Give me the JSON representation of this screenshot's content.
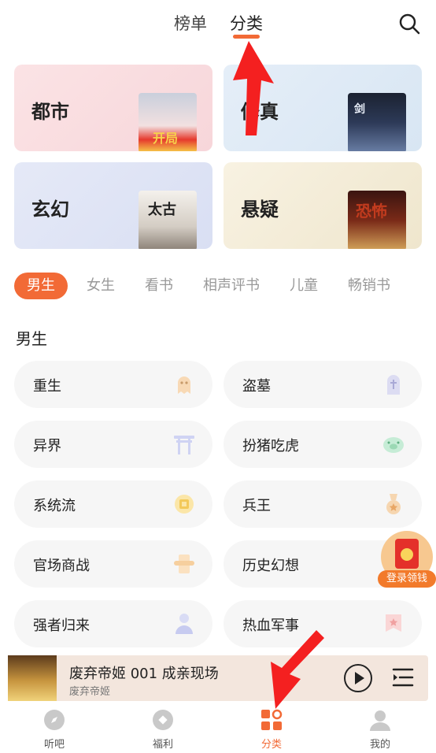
{
  "header": {
    "tabs": [
      {
        "label": "榜单",
        "active": false
      },
      {
        "label": "分类",
        "active": true
      }
    ],
    "search_icon": "search-icon",
    "accent_color": "#f26a36"
  },
  "category_cards": [
    {
      "label": "都市",
      "cover_text": "开局"
    },
    {
      "label": "修真",
      "cover_text": "剑"
    },
    {
      "label": "玄幻",
      "cover_text": "太古"
    },
    {
      "label": "悬疑",
      "cover_text": "恐怖"
    }
  ],
  "chips": [
    "男生",
    "女生",
    "看书",
    "相声评书",
    "儿童",
    "畅销书"
  ],
  "section": {
    "title": "男生",
    "items": [
      {
        "label": "重生",
        "icon": "ghost-icon"
      },
      {
        "label": "盗墓",
        "icon": "tombstone-icon"
      },
      {
        "label": "异界",
        "icon": "torii-gate-icon"
      },
      {
        "label": "扮猪吃虎",
        "icon": "pig-icon"
      },
      {
        "label": "系统流",
        "icon": "chip-icon"
      },
      {
        "label": "兵王",
        "icon": "medal-icon"
      },
      {
        "label": "官场商战",
        "icon": "scroll-icon"
      },
      {
        "label": "历史幻想",
        "icon": "book-icon"
      },
      {
        "label": "强者归来",
        "icon": "person-icon"
      },
      {
        "label": "热血军事",
        "icon": "star-badge-icon"
      }
    ]
  },
  "reward": {
    "label": "登录领钱"
  },
  "player": {
    "title": "废弃帝姬 001 成亲现场",
    "subtitle": "废弃帝姬"
  },
  "nav": [
    {
      "label": "听吧",
      "icon": "compass-icon",
      "active": false
    },
    {
      "label": "福利",
      "icon": "gift-icon",
      "active": false
    },
    {
      "label": "分类",
      "icon": "grid-icon",
      "active": true
    },
    {
      "label": "我的",
      "icon": "user-icon",
      "active": false
    }
  ]
}
